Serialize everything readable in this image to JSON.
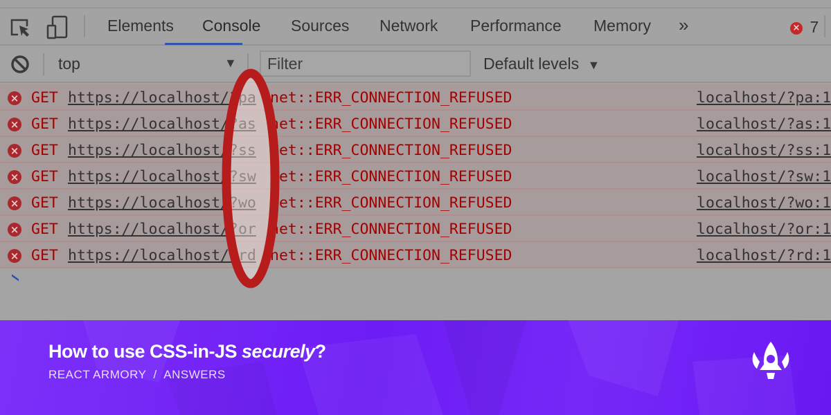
{
  "tabs": {
    "items": [
      {
        "label": "Elements",
        "active": false
      },
      {
        "label": "Console",
        "active": true
      },
      {
        "label": "Sources",
        "active": false
      },
      {
        "label": "Network",
        "active": false
      },
      {
        "label": "Performance",
        "active": false
      },
      {
        "label": "Memory",
        "active": false
      }
    ],
    "more": "»",
    "error_count": "7"
  },
  "toolbar": {
    "context": "top",
    "filter_placeholder": "Filter",
    "levels": "Default levels"
  },
  "console": {
    "rows": [
      {
        "method": "GET",
        "url": "https://localhost/?pa",
        "message": "net::ERR_CONNECTION_REFUSED",
        "source": "localhost/?pa:1"
      },
      {
        "method": "GET",
        "url": "https://localhost/?as",
        "message": "net::ERR_CONNECTION_REFUSED",
        "source": "localhost/?as:1"
      },
      {
        "method": "GET",
        "url": "https://localhost/?ss",
        "message": "net::ERR_CONNECTION_REFUSED",
        "source": "localhost/?ss:1"
      },
      {
        "method": "GET",
        "url": "https://localhost/?sw",
        "message": "net::ERR_CONNECTION_REFUSED",
        "source": "localhost/?sw:1"
      },
      {
        "method": "GET",
        "url": "https://localhost/?wo",
        "message": "net::ERR_CONNECTION_REFUSED",
        "source": "localhost/?wo:1"
      },
      {
        "method": "GET",
        "url": "https://localhost/?or",
        "message": "net::ERR_CONNECTION_REFUSED",
        "source": "localhost/?or:1"
      },
      {
        "method": "GET",
        "url": "https://localhost/?rd",
        "message": "net::ERR_CONNECTION_REFUSED",
        "source": "localhost/?rd:1"
      }
    ]
  },
  "banner": {
    "title_main": "How to use CSS-in-JS ",
    "title_em": "securely",
    "title_end": "?",
    "subtitle": "REACT ARMORY  /  ANSWERS",
    "color": "#7326f7"
  },
  "colors": {
    "error": "#a50000",
    "highlight_oval": "#b71c1c",
    "tab_underline": "#2d56a8"
  }
}
